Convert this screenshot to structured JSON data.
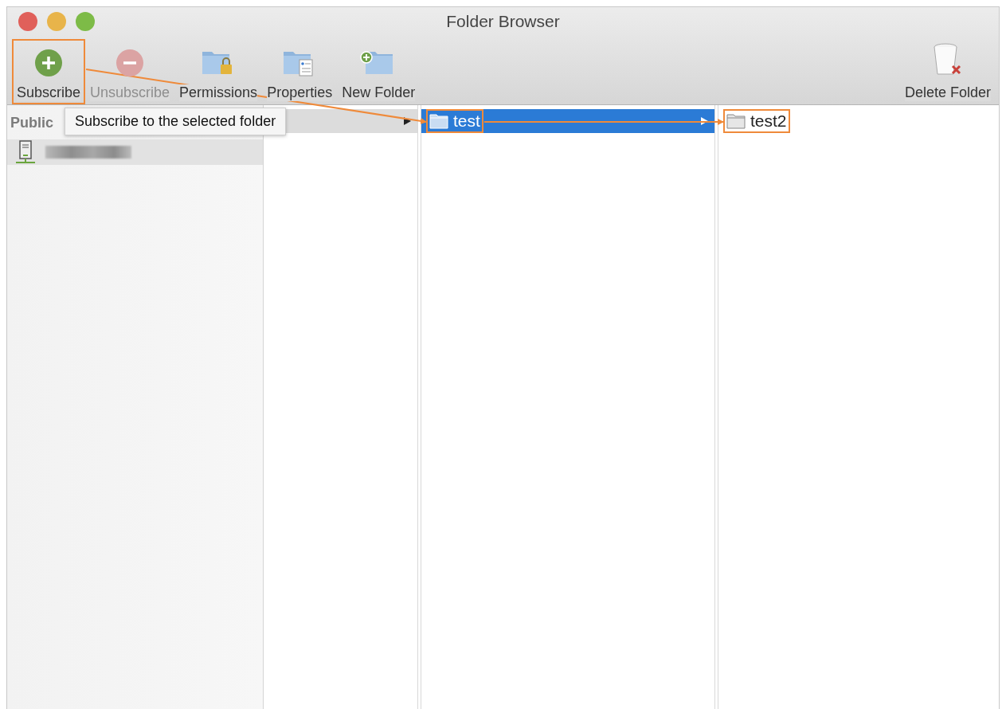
{
  "window": {
    "title": "Folder Browser"
  },
  "toolbar": [
    {
      "label": "Subscribe",
      "kind": "add",
      "disabled": false,
      "callout": true
    },
    {
      "label": "Unsubscribe",
      "kind": "remove",
      "disabled": true,
      "callout": false
    },
    {
      "label": "Permissions",
      "kind": "permissions",
      "disabled": false,
      "callout": false
    },
    {
      "label": "Properties",
      "kind": "properties",
      "disabled": false,
      "callout": false
    },
    {
      "label": "New Folder",
      "kind": "newfolder",
      "disabled": false,
      "callout": false
    },
    {
      "label": "Delete Folder",
      "kind": "delete",
      "disabled": false,
      "callout": false
    }
  ],
  "sidebar": {
    "header": "Public",
    "items": [
      {
        "kind": "server",
        "redacted": true,
        "selected": true
      }
    ]
  },
  "tooltip": {
    "text": "Subscribe to the selected folder"
  },
  "columns": [
    {
      "items": [
        {
          "selected": true,
          "active": false,
          "has_children": true
        }
      ]
    },
    {
      "items": [
        {
          "label": "test",
          "selected": true,
          "active": true,
          "has_children": true,
          "callout": true
        }
      ]
    },
    {
      "items": [
        {
          "label": "test2",
          "selected": false,
          "active": false,
          "has_children": false,
          "callout": true
        }
      ]
    }
  ],
  "callout_arrows": true
}
